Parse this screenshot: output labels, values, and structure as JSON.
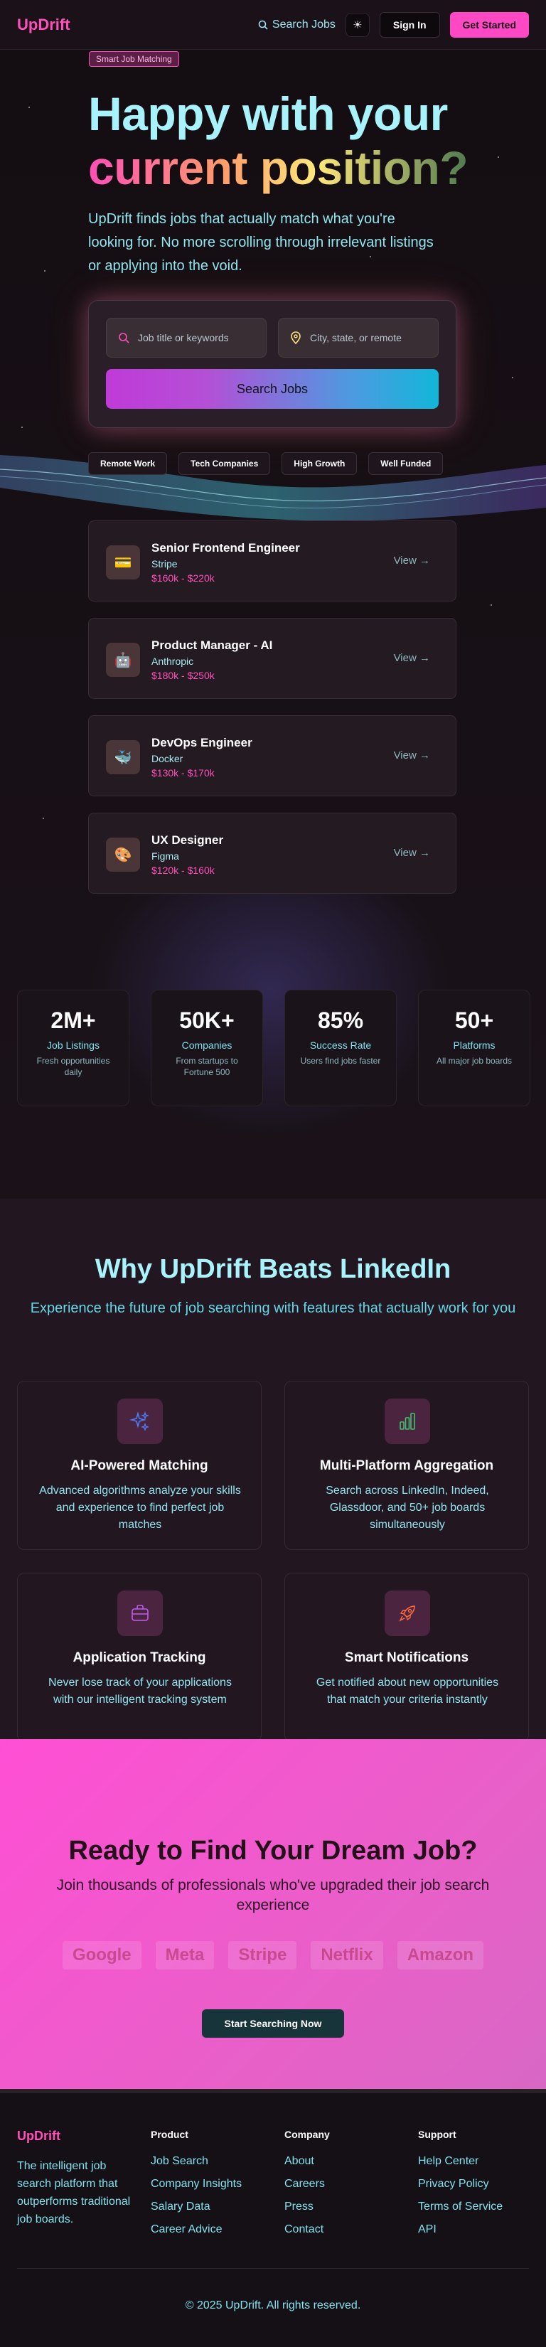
{
  "header": {
    "logo": "UpDrift",
    "search_label": "Search Jobs",
    "theme_icon": "sun-icon",
    "signin_label": "Sign In",
    "get_started_label": "Get Started"
  },
  "hero": {
    "badge": "Smart Job Matching",
    "title_line1": "Happy with your",
    "title_line2": "current position?",
    "subtitle": "UpDrift finds jobs that actually match what you're looking for. No more scrolling through irrelevant listings or applying into the void.",
    "job_placeholder": "Job title or keywords",
    "location_placeholder": "City, state, or remote",
    "search_button": "Search Jobs",
    "tags": [
      "Remote Work",
      "Tech Companies",
      "High Growth",
      "Well Funded"
    ]
  },
  "jobs": [
    {
      "title": "Senior Frontend Engineer",
      "company": "Stripe",
      "salary": "$160k - $220k",
      "icon": "💳",
      "view": "View →"
    },
    {
      "title": "Product Manager - AI",
      "company": "Anthropic",
      "salary": "$180k - $250k",
      "icon": "🤖",
      "view": "View →"
    },
    {
      "title": "DevOps Engineer",
      "company": "Docker",
      "salary": "$130k - $170k",
      "icon": "🐳",
      "view": "View →"
    },
    {
      "title": "UX Designer",
      "company": "Figma",
      "salary": "$120k - $160k",
      "icon": "🎨",
      "view": "View →"
    }
  ],
  "stats": [
    {
      "value": "2M+",
      "label": "Job Listings",
      "desc": "Fresh opportunities daily"
    },
    {
      "value": "50K+",
      "label": "Companies",
      "desc": "From startups to Fortune 500"
    },
    {
      "value": "85%",
      "label": "Success Rate",
      "desc": "Users find jobs faster"
    },
    {
      "value": "50+",
      "label": "Platforms",
      "desc": "All major job boards"
    }
  ],
  "features": {
    "title": "Why UpDrift Beats LinkedIn",
    "subtitle": "Experience the future of job searching with features that actually work for you",
    "items": [
      {
        "title": "AI-Powered Matching",
        "desc": "Advanced algorithms analyze your skills and experience to find perfect job matches",
        "icon": "sparkles-icon"
      },
      {
        "title": "Multi-Platform Aggregation",
        "desc": "Search across LinkedIn, Indeed, Glassdoor, and 50+ job boards simultaneously",
        "icon": "bar-chart-icon"
      },
      {
        "title": "Application Tracking",
        "desc": "Never lose track of your applications with our intelligent tracking system",
        "icon": "briefcase-icon"
      },
      {
        "title": "Smart Notifications",
        "desc": "Get notified about new opportunities that match your criteria instantly",
        "icon": "rocket-icon"
      }
    ]
  },
  "cta": {
    "title": "Ready to Find Your Dream Job?",
    "subtitle": "Join thousands of professionals who've upgraded their job search experience",
    "logos": [
      "Google",
      "Meta",
      "Stripe",
      "Netflix",
      "Amazon"
    ],
    "button": "Start Searching Now"
  },
  "footer": {
    "brand": "UpDrift",
    "description": "The intelligent job search platform that outperforms traditional job boards.",
    "columns": [
      {
        "title": "Product",
        "links": [
          "Job Search",
          "Company Insights",
          "Salary Data",
          "Career Advice"
        ]
      },
      {
        "title": "Company",
        "links": [
          "About",
          "Careers",
          "Press",
          "Contact"
        ]
      },
      {
        "title": "Support",
        "links": [
          "Help Center",
          "Privacy Policy",
          "Terms of Service",
          "API"
        ]
      }
    ],
    "copyright": "© 2025 UpDrift. All rights reserved."
  },
  "colors": {
    "brand_pink": "#ff4fb8",
    "accent_cyan": "#a7f2fb",
    "background": "#160f14"
  }
}
